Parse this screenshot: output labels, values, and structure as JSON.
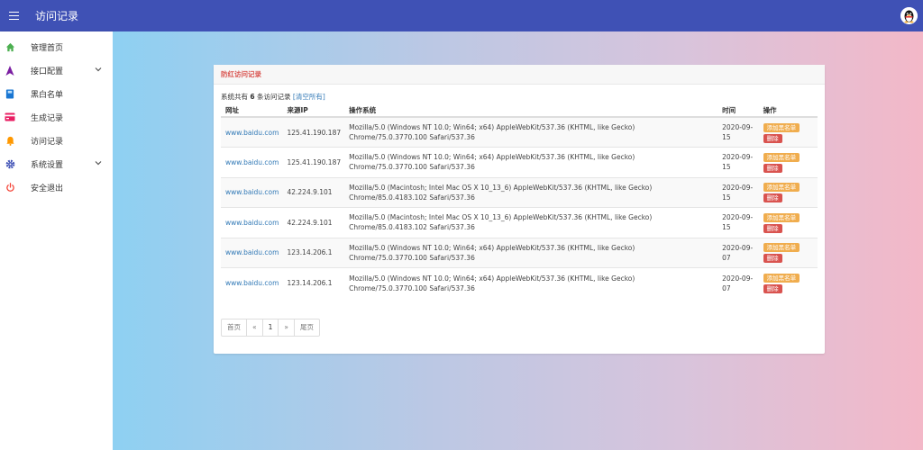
{
  "header": {
    "title": "访问记录"
  },
  "sidebar": {
    "items": [
      {
        "label": "管理首页",
        "icon": "home-icon",
        "color": "#4caf50"
      },
      {
        "label": "接口配置",
        "icon": "navigation-icon",
        "color": "#7b1fa2",
        "expandable": true
      },
      {
        "label": "黑白名单",
        "icon": "book-icon",
        "color": "#1976d2"
      },
      {
        "label": "生成记录",
        "icon": "card-icon",
        "color": "#e91e63"
      },
      {
        "label": "访问记录",
        "icon": "bell-icon",
        "color": "#ff9800"
      },
      {
        "label": "系统设置",
        "icon": "gear-icon",
        "color": "#3f51b5",
        "expandable": true
      },
      {
        "label": "安全退出",
        "icon": "power-icon",
        "color": "#f44336"
      }
    ]
  },
  "panel": {
    "title": "防红访问记录",
    "summary": {
      "prefix": "系统共有 ",
      "count": "6",
      "suffix": " 条访问记录 ",
      "clear_link": "[清空所有]"
    },
    "columns": [
      "网址",
      "来源IP",
      "操作系统",
      "时间",
      "操作"
    ],
    "rows": [
      {
        "url": "www.baidu.com",
        "ip": "125.41.190.187",
        "ua": "Mozilla/5.0 (Windows NT 10.0; Win64; x64) AppleWebKit/537.36 (KHTML, like Gecko) Chrome/75.0.3770.100 Safari/537.36",
        "date1": "2020-09-",
        "date2": "15"
      },
      {
        "url": "www.baidu.com",
        "ip": "125.41.190.187",
        "ua": "Mozilla/5.0 (Windows NT 10.0; Win64; x64) AppleWebKit/537.36 (KHTML, like Gecko) Chrome/75.0.3770.100 Safari/537.36",
        "date1": "2020-09-",
        "date2": "15"
      },
      {
        "url": "www.baidu.com",
        "ip": "42.224.9.101",
        "ua": "Mozilla/5.0 (Macintosh; Intel Mac OS X 10_13_6) AppleWebKit/537.36 (KHTML, like Gecko) Chrome/85.0.4183.102 Safari/537.36",
        "date1": "2020-09-",
        "date2": "15"
      },
      {
        "url": "www.baidu.com",
        "ip": "42.224.9.101",
        "ua": "Mozilla/5.0 (Macintosh; Intel Mac OS X 10_13_6) AppleWebKit/537.36 (KHTML, like Gecko) Chrome/85.0.4183.102 Safari/537.36",
        "date1": "2020-09-",
        "date2": "15"
      },
      {
        "url": "www.baidu.com",
        "ip": "123.14.206.1",
        "ua": "Mozilla/5.0 (Windows NT 10.0; Win64; x64) AppleWebKit/537.36 (KHTML, like Gecko) Chrome/75.0.3770.100 Safari/537.36",
        "date1": "2020-09-",
        "date2": "07"
      },
      {
        "url": "www.baidu.com",
        "ip": "123.14.206.1",
        "ua": "Mozilla/5.0 (Windows NT 10.0; Win64; x64) AppleWebKit/537.36 (KHTML, like Gecko) Chrome/75.0.3770.100 Safari/537.36",
        "date1": "2020-09-",
        "date2": "07"
      }
    ],
    "actions": {
      "blacklist": "添加黑名单",
      "delete": "删除"
    },
    "pager": {
      "first": "首页",
      "prev": "«",
      "current": "1",
      "next": "»",
      "last": "尾页"
    }
  },
  "colors": {
    "topbar": "#3f51b5",
    "warn": "#f0ad4e",
    "danger": "#d9534f",
    "link": "#337ab7"
  }
}
